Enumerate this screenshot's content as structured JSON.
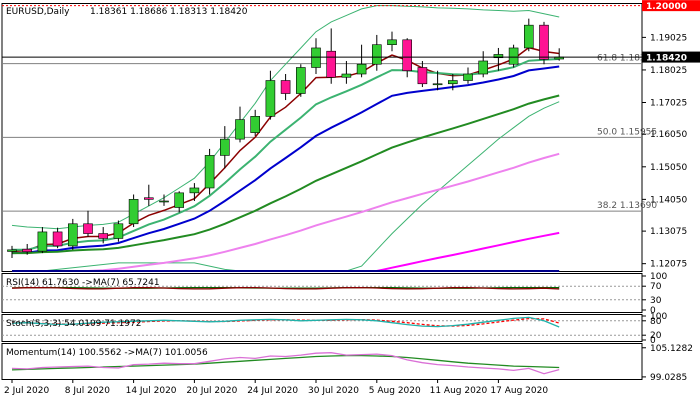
{
  "chart_data": {
    "type": "candlestick",
    "symbol_label": "EURUSD,Daily",
    "ohlc_label": "1.18361 1.18686 1.18313 1.18420",
    "main_price_labels": [
      "1.19025",
      "1.18025",
      "1.17025",
      "1.16050",
      "1.15050",
      "1.14050",
      "1.13075",
      "1.12075"
    ],
    "main_price_values": [
      1.19025,
      1.18025,
      1.17025,
      1.1605,
      1.1505,
      1.1405,
      1.13075,
      1.12075
    ],
    "ylim": [
      1.1185,
      1.2005
    ],
    "current_price": 1.1842,
    "current_price_label": "1.18420",
    "top_level": 1.2,
    "top_level_label": "1.20000",
    "fib_levels": [
      {
        "label": "61.8 1.18220",
        "value": 1.1822
      },
      {
        "label": "50.0 1.15955",
        "value": 1.15955
      },
      {
        "label": "38.2 1.13690",
        "value": 1.1369
      }
    ],
    "x_labels": [
      "2 Jul 2020",
      "8 Jul 2020",
      "14 Jul 2020",
      "20 Jul 2020",
      "24 Jul 2020",
      "30 Jul 2020",
      "5 Aug 2020",
      "11 Aug 2020",
      "17 Aug 2020"
    ],
    "x_label_bar_index": [
      0,
      4,
      8,
      12,
      16,
      20,
      24,
      28,
      32
    ],
    "candles": [
      {
        "o": 1.1245,
        "h": 1.1262,
        "l": 1.1225,
        "c": 1.125
      },
      {
        "o": 1.1252,
        "h": 1.1268,
        "l": 1.1235,
        "c": 1.1244
      },
      {
        "o": 1.1246,
        "h": 1.132,
        "l": 1.124,
        "c": 1.1305
      },
      {
        "o": 1.1305,
        "h": 1.1318,
        "l": 1.1255,
        "c": 1.1262
      },
      {
        "o": 1.1262,
        "h": 1.1345,
        "l": 1.125,
        "c": 1.133
      },
      {
        "o": 1.133,
        "h": 1.137,
        "l": 1.129,
        "c": 1.13
      },
      {
        "o": 1.13,
        "h": 1.132,
        "l": 1.127,
        "c": 1.1285
      },
      {
        "o": 1.1285,
        "h": 1.134,
        "l": 1.1275,
        "c": 1.133
      },
      {
        "o": 1.133,
        "h": 1.142,
        "l": 1.132,
        "c": 1.1405
      },
      {
        "o": 1.141,
        "h": 1.145,
        "l": 1.1385,
        "c": 1.1405
      },
      {
        "o": 1.14,
        "h": 1.142,
        "l": 1.1385,
        "c": 1.14
      },
      {
        "o": 1.138,
        "h": 1.143,
        "l": 1.1365,
        "c": 1.1425
      },
      {
        "o": 1.1425,
        "h": 1.1455,
        "l": 1.14,
        "c": 1.144
      },
      {
        "o": 1.144,
        "h": 1.156,
        "l": 1.142,
        "c": 1.154
      },
      {
        "o": 1.154,
        "h": 1.163,
        "l": 1.15,
        "c": 1.159
      },
      {
        "o": 1.159,
        "h": 1.169,
        "l": 1.158,
        "c": 1.165
      },
      {
        "o": 1.161,
        "h": 1.168,
        "l": 1.16,
        "c": 1.166
      },
      {
        "o": 1.166,
        "h": 1.18,
        "l": 1.165,
        "c": 1.177
      },
      {
        "o": 1.177,
        "h": 1.179,
        "l": 1.171,
        "c": 1.173
      },
      {
        "o": 1.173,
        "h": 1.182,
        "l": 1.172,
        "c": 1.181
      },
      {
        "o": 1.181,
        "h": 1.19,
        "l": 1.179,
        "c": 1.187
      },
      {
        "o": 1.186,
        "h": 1.193,
        "l": 1.176,
        "c": 1.178
      },
      {
        "o": 1.178,
        "h": 1.183,
        "l": 1.176,
        "c": 1.179
      },
      {
        "o": 1.179,
        "h": 1.188,
        "l": 1.178,
        "c": 1.182
      },
      {
        "o": 1.182,
        "h": 1.191,
        "l": 1.18,
        "c": 1.188
      },
      {
        "o": 1.188,
        "h": 1.192,
        "l": 1.186,
        "c": 1.1895
      },
      {
        "o": 1.1895,
        "h": 1.19,
        "l": 1.178,
        "c": 1.18
      },
      {
        "o": 1.181,
        "h": 1.183,
        "l": 1.175,
        "c": 1.176
      },
      {
        "o": 1.176,
        "h": 1.18,
        "l": 1.174,
        "c": 1.176
      },
      {
        "o": 1.176,
        "h": 1.179,
        "l": 1.174,
        "c": 1.177
      },
      {
        "o": 1.177,
        "h": 1.181,
        "l": 1.176,
        "c": 1.179
      },
      {
        "o": 1.179,
        "h": 1.186,
        "l": 1.178,
        "c": 1.183
      },
      {
        "o": 1.184,
        "h": 1.187,
        "l": 1.18,
        "c": 1.185
      },
      {
        "o": 1.182,
        "h": 1.188,
        "l": 1.181,
        "c": 1.187
      },
      {
        "o": 1.187,
        "h": 1.196,
        "l": 1.186,
        "c": 1.194
      },
      {
        "o": 1.194,
        "h": 1.195,
        "l": 1.182,
        "c": 1.1835
      },
      {
        "o": 1.1836,
        "h": 1.1869,
        "l": 1.1831,
        "c": 1.1842
      }
    ],
    "moving_averages": [
      {
        "color": "#8b0000",
        "values": [
          1.1245,
          1.1248,
          1.1266,
          1.1268,
          1.1285,
          1.1291,
          1.1291,
          1.1302,
          1.1332,
          1.1356,
          1.1371,
          1.1389,
          1.1407,
          1.1453,
          1.1502,
          1.1555,
          1.1596,
          1.1658,
          1.1688,
          1.173,
          1.1779,
          1.178,
          1.1783,
          1.1796,
          1.1824,
          1.1848,
          1.1832,
          1.1808,
          1.1792,
          1.1785,
          1.1787,
          1.1802,
          1.1818,
          1.1836,
          1.1871,
          1.1859,
          1.1853
        ]
      },
      {
        "color": "#3cb371",
        "values": [
          1.125,
          1.125,
          1.1262,
          1.1262,
          1.1272,
          1.1277,
          1.1279,
          1.1288,
          1.1308,
          1.1328,
          1.1343,
          1.1363,
          1.1384,
          1.1416,
          1.1455,
          1.1497,
          1.1536,
          1.1582,
          1.1619,
          1.1656,
          1.1697,
          1.1718,
          1.1737,
          1.1757,
          1.178,
          1.1802,
          1.1801,
          1.1796,
          1.1793,
          1.1789,
          1.1788,
          1.1793,
          1.1801,
          1.1811,
          1.1831,
          1.1834,
          1.1836
        ]
      },
      {
        "color": "#0000cd",
        "values": [
          1.124,
          1.1241,
          1.1248,
          1.1249,
          1.1256,
          1.126,
          1.1263,
          1.1271,
          1.1286,
          1.1301,
          1.1314,
          1.133,
          1.1346,
          1.137,
          1.14,
          1.1432,
          1.1464,
          1.15,
          1.1532,
          1.1565,
          1.16,
          1.1625,
          1.1648,
          1.1672,
          1.1698,
          1.1723,
          1.1732,
          1.1738,
          1.1744,
          1.175,
          1.1756,
          1.1764,
          1.1773,
          1.1784,
          1.1801,
          1.1807,
          1.1813
        ]
      },
      {
        "color": "#228b22",
        "values": [
          1.124,
          1.124,
          1.1243,
          1.1244,
          1.1248,
          1.125,
          1.1252,
          1.1256,
          1.1264,
          1.1272,
          1.128,
          1.1289,
          1.1298,
          1.1312,
          1.133,
          1.135,
          1.137,
          1.1393,
          1.1414,
          1.1437,
          1.1462,
          1.1482,
          1.1502,
          1.1522,
          1.1543,
          1.1564,
          1.158,
          1.1595,
          1.1609,
          1.1623,
          1.1637,
          1.1652,
          1.1667,
          1.1682,
          1.1699,
          1.1712,
          1.1724
        ]
      },
      {
        "color": "#ee82ee",
        "values": [
          1.116,
          1.1165,
          1.117,
          1.1174,
          1.1179,
          1.1183,
          1.1187,
          1.1192,
          1.1198,
          1.1204,
          1.121,
          1.1217,
          1.1224,
          1.1233,
          1.1244,
          1.1256,
          1.1268,
          1.1282,
          1.1295,
          1.1309,
          1.1325,
          1.1339,
          1.1352,
          1.1366,
          1.1381,
          1.1396,
          1.1409,
          1.1422,
          1.1434,
          1.1447,
          1.146,
          1.1474,
          1.1488,
          1.1502,
          1.1518,
          1.1532,
          1.1545
        ]
      },
      {
        "color": "#ff00ff",
        "values": [
          1.095,
          1.0958,
          1.0966,
          1.0974,
          1.0982,
          1.099,
          1.0998,
          1.1006,
          1.1014,
          1.1023,
          1.1032,
          1.1041,
          1.105,
          1.106,
          1.1071,
          1.1082,
          1.1093,
          1.1105,
          1.1116,
          1.1128,
          1.114,
          1.1151,
          1.1162,
          1.1173,
          1.1184,
          1.1195,
          1.1205,
          1.1215,
          1.1225,
          1.1234,
          1.1244,
          1.1254,
          1.1264,
          1.1274,
          1.1284,
          1.1293,
          1.1302
        ]
      },
      {
        "color": "#00008b",
        "values": [
          1.072,
          1.0726,
          1.0732,
          1.0738,
          1.0744,
          1.075,
          1.0756,
          1.0762,
          1.0768,
          1.0774,
          1.078,
          1.0786,
          1.0792,
          1.0799,
          1.0806,
          1.0813,
          1.082,
          1.0828,
          1.0835,
          1.0843,
          1.0851,
          1.0858,
          1.0865,
          1.0873,
          1.0881,
          1.0889,
          1.0896,
          1.0903,
          1.091,
          1.0917,
          1.0924,
          1.0931,
          1.0938,
          1.0945,
          1.0952,
          1.0959,
          1.0966
        ]
      }
    ],
    "bollinger": {
      "color": "#3cb371",
      "upper": [
        1.1325,
        1.132,
        1.1318,
        1.1315,
        1.132,
        1.1325,
        1.1328,
        1.1335,
        1.136,
        1.1385,
        1.141,
        1.144,
        1.147,
        1.152,
        1.158,
        1.164,
        1.17,
        1.177,
        1.182,
        1.187,
        1.192,
        1.195,
        1.197,
        1.199,
        1.2,
        1.2,
        1.1998,
        1.1996,
        1.1993,
        1.1992,
        1.199,
        1.1987,
        1.1985,
        1.1983,
        1.1985,
        1.1975,
        1.1965
      ],
      "lower": [
        1.1175,
        1.118,
        1.1185,
        1.119,
        1.1195,
        1.12,
        1.1205,
        1.121,
        1.121,
        1.121,
        1.121,
        1.121,
        1.121,
        1.12,
        1.119,
        1.1175,
        1.116,
        1.114,
        1.1125,
        1.111,
        1.11,
        1.1125,
        1.116,
        1.12,
        1.125,
        1.13,
        1.1345,
        1.139,
        1.143,
        1.147,
        1.151,
        1.155,
        1.159,
        1.1625,
        1.166,
        1.1685,
        1.1705
      ]
    },
    "rsi": {
      "label": "RSI(14) 61.7630  ->MA(7) 65.7241",
      "scale_labels": [
        "100",
        "70",
        "30",
        "0"
      ],
      "scale_values": [
        100,
        70,
        30,
        0
      ],
      "current": 61.763,
      "ma": 65.7241
    },
    "stochastic": {
      "label": "Stoch(5,3,3) 54.0109 71.1972",
      "scale_labels": [
        "100",
        "80",
        "20",
        "0"
      ],
      "scale_values": [
        100,
        80,
        20,
        0
      ],
      "main": [
        70,
        72,
        68,
        65,
        66,
        70,
        74,
        76,
        78,
        80,
        82,
        80,
        78,
        76,
        78,
        82,
        84,
        86,
        84,
        80,
        82,
        84,
        86,
        84,
        80,
        72,
        64,
        58,
        56,
        60,
        66,
        74,
        82,
        90,
        94,
        80,
        54
      ],
      "signal": [
        72,
        71,
        69,
        67,
        66,
        67,
        70,
        72,
        74,
        77,
        79,
        80,
        79,
        77,
        77,
        79,
        82,
        84,
        84,
        83,
        82,
        82,
        84,
        85,
        83,
        78,
        72,
        65,
        59,
        58,
        61,
        67,
        75,
        83,
        89,
        88,
        71
      ]
    },
    "momentum": {
      "label": "Momentum(14) 100.5562  ->MA(7) 101.0056",
      "scale_labels": [
        "105.1282",
        "99.0285"
      ],
      "scale_values": [
        105.1282,
        99.0285
      ],
      "main": [
        100.8,
        100.7,
        101.0,
        101.1,
        101.2,
        101.3,
        101.0,
        100.9,
        101.6,
        101.7,
        101.9,
        101.8,
        101.8,
        102.3,
        102.8,
        103.1,
        102.9,
        103.4,
        103.3,
        103.6,
        104.0,
        104.1,
        103.6,
        103.7,
        103.8,
        103.5,
        102.6,
        102.0,
        101.6,
        101.4,
        101.1,
        100.9,
        100.7,
        100.4,
        100.8,
        99.7,
        100.5562
      ],
      "ma": [
        100.5,
        100.6,
        100.7,
        100.8,
        100.9,
        101.0,
        101.1,
        101.2,
        101.3,
        101.4,
        101.5,
        101.6,
        101.7,
        101.9,
        102.1,
        102.3,
        102.5,
        102.7,
        102.9,
        103.1,
        103.3,
        103.4,
        103.5,
        103.5,
        103.4,
        103.3,
        103.1,
        102.8,
        102.5,
        102.2,
        101.9,
        101.7,
        101.5,
        101.3,
        101.2,
        101.1,
        101.0056
      ]
    }
  }
}
